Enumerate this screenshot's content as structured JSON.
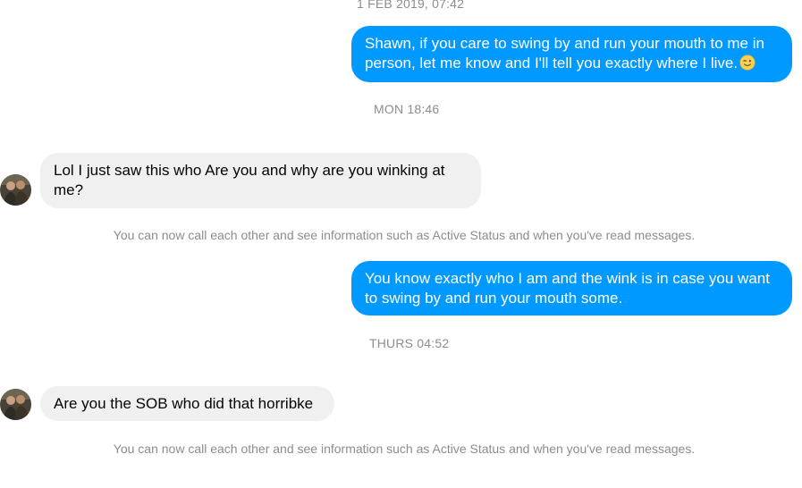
{
  "conversation": {
    "timestamps": [
      "1 FEB 2019, 07:42",
      "MON 18:46",
      "THURS 04:52"
    ],
    "messages": [
      {
        "direction": "outgoing",
        "text": "Shawn, if you care to swing by and run your mouth to me in person, let me know and I'll tell you exactly where I live.",
        "emoji": "winking-face-emoji"
      },
      {
        "direction": "incoming",
        "text": "Lol I just saw this who Are you and why are you winking at me?"
      },
      {
        "direction": "outgoing",
        "text": "You know exactly who I am and the wink is in case you want to swing by and run your mouth some."
      },
      {
        "direction": "incoming",
        "text": "Are you the SOB who did that horribke"
      }
    ],
    "system_notes": [
      "You can now call each other and see information such as Active Status and when you've read messages.",
      "You can now call each other and see information such as Active Status and when you've read messages."
    ]
  },
  "colors": {
    "outgoing_bubble": "#0099ff",
    "incoming_bubble": "#f0f0f0",
    "meta_text": "#8a8d91"
  }
}
